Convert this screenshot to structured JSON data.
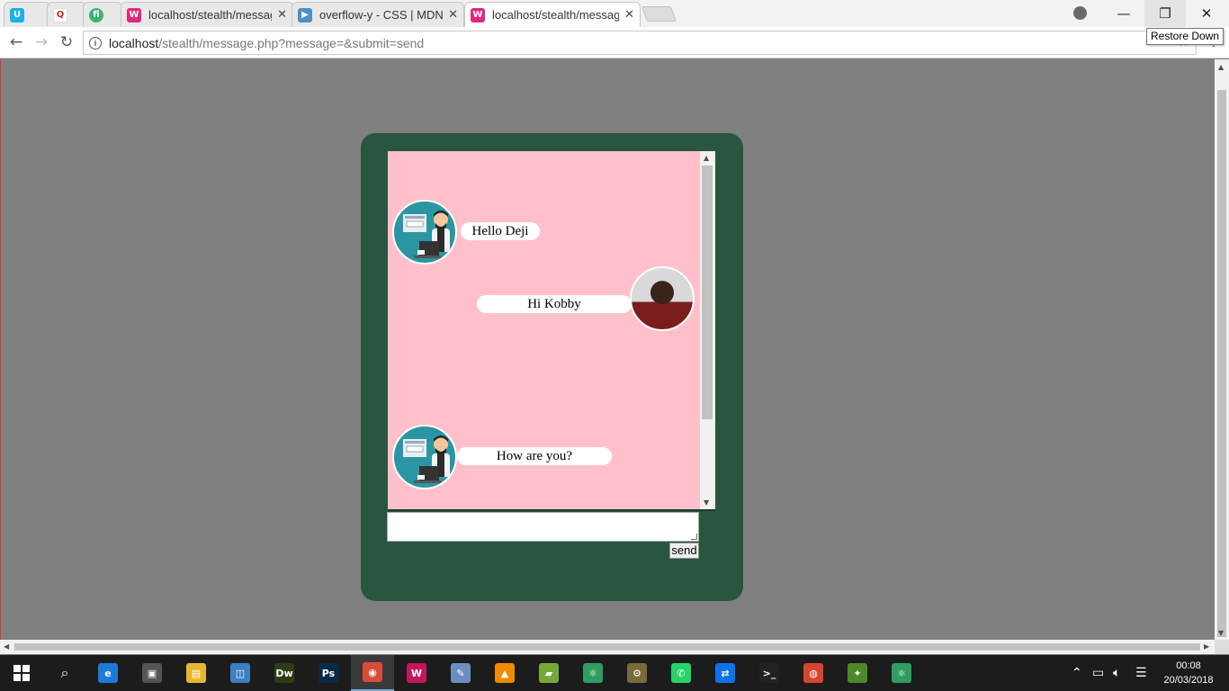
{
  "browser": {
    "tabs": [
      {
        "label": "",
        "icon": "u-logo-icon",
        "color": "#1ab2e8"
      },
      {
        "label": "",
        "icon": "q-logo-icon",
        "color": "#b92b27"
      },
      {
        "label": "",
        "icon": "fi-logo-icon",
        "color": "#3cb371"
      },
      {
        "label": "localhost/stealth/messag",
        "icon": "wamp-icon",
        "color": "#e0287a"
      },
      {
        "label": "overflow-y - CSS | MDN",
        "icon": "mdn-icon",
        "color": "#4d8fc7"
      },
      {
        "label": "localhost/stealth/messag",
        "icon": "wamp-icon",
        "color": "#e0287a"
      }
    ],
    "url_host": "localhost",
    "url_path": "/stealth/message.php?message=&submit=send",
    "tooltip": "Restore Down"
  },
  "chat": {
    "messages": [
      {
        "text": "Hello Deji",
        "sender": "left"
      },
      {
        "text": "Hi Kobby",
        "sender": "right"
      },
      {
        "text": "How are you?",
        "sender": "left"
      }
    ],
    "input_value": "",
    "send_label": "send"
  },
  "taskbar": {
    "apps": [
      {
        "name": "edge",
        "glyph": "e",
        "color": "#1e7ad6"
      },
      {
        "name": "store",
        "glyph": "▣",
        "color": "#555"
      },
      {
        "name": "file-explorer",
        "glyph": "▤",
        "color": "#e8b730"
      },
      {
        "name": "control-panel",
        "glyph": "◫",
        "color": "#3a7fc4"
      },
      {
        "name": "dreamweaver",
        "glyph": "Dw",
        "color": "#2f3b15"
      },
      {
        "name": "photoshop",
        "glyph": "Ps",
        "color": "#0b2a48"
      },
      {
        "name": "chrome",
        "glyph": "◉",
        "color": "#d94c3a"
      },
      {
        "name": "wamp",
        "glyph": "W",
        "color": "#c2185b"
      },
      {
        "name": "paint",
        "glyph": "✎",
        "color": "#6a8fbf"
      },
      {
        "name": "vlc",
        "glyph": "▲",
        "color": "#f08a00"
      },
      {
        "name": "photos",
        "glyph": "▰",
        "color": "#77a83a"
      },
      {
        "name": "atom",
        "glyph": "⚛",
        "color": "#2e9d5f"
      },
      {
        "name": "settings",
        "glyph": "⚙",
        "color": "#7a6a3a"
      },
      {
        "name": "whatsapp",
        "glyph": "✆",
        "color": "#25d366"
      },
      {
        "name": "teamviewer",
        "glyph": "⇄",
        "color": "#0e72ed"
      },
      {
        "name": "terminal",
        "glyph": ">_",
        "color": "#222"
      },
      {
        "name": "snail-app",
        "glyph": "◍",
        "color": "#d6452e"
      },
      {
        "name": "game-app",
        "glyph": "✦",
        "color": "#4a8a2a"
      },
      {
        "name": "atom-2",
        "glyph": "⚛",
        "color": "#2e9d5f"
      }
    ],
    "time": "00:08",
    "date": "20/03/2018"
  }
}
